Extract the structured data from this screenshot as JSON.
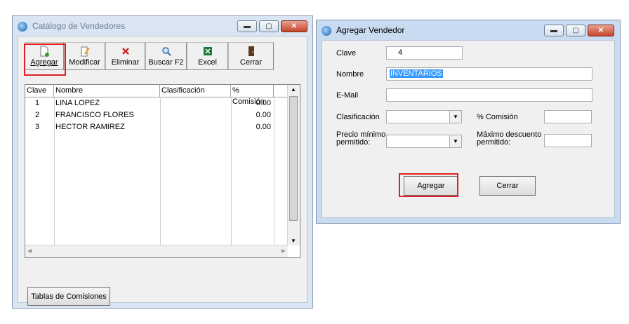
{
  "catalog_window": {
    "title": "Catálogo de Vendedores",
    "toolbar": [
      {
        "label": "Agregar",
        "icon": "new-document-icon"
      },
      {
        "label": "Modificar",
        "icon": "edit-icon"
      },
      {
        "label": "Eliminar",
        "icon": "delete-x-icon"
      },
      {
        "label": "Buscar F2",
        "icon": "search-icon"
      },
      {
        "label": "Excel",
        "icon": "excel-icon"
      },
      {
        "label": "Cerrar",
        "icon": "door-icon"
      }
    ],
    "grid": {
      "columns": [
        "Clave",
        "Nombre",
        "Clasificación",
        "% Comisión"
      ],
      "rows": [
        {
          "clave": "1",
          "nombre": "LINA LOPEZ",
          "clasificacion": "",
          "comision": "0.00"
        },
        {
          "clave": "2",
          "nombre": "FRANCISCO FLORES",
          "clasificacion": "",
          "comision": "0.00"
        },
        {
          "clave": "3",
          "nombre": "HECTOR RAMIREZ",
          "clasificacion": "",
          "comision": "0.00"
        }
      ]
    },
    "tablas_button": "Tablas de Comisiones"
  },
  "add_window": {
    "title": "Agregar Vendedor",
    "labels": {
      "clave": "Clave",
      "nombre": "Nombre",
      "email": "E-Mail",
      "clasificacion": "Clasificación",
      "comision": "% Comisión",
      "precio_minimo": "Precio mínimo permitido:",
      "maximo_descuento": "Máximo descuento permitido:"
    },
    "values": {
      "clave": "4",
      "nombre": "INVENTARIOS",
      "email": "",
      "clasificacion": "",
      "comision": "",
      "precio_minimo": "",
      "maximo_descuento": ""
    },
    "buttons": {
      "agregar": "Agregar",
      "cerrar": "Cerrar"
    }
  },
  "colors": {
    "highlight_red": "#e02020",
    "selection_blue": "#3399ff"
  }
}
